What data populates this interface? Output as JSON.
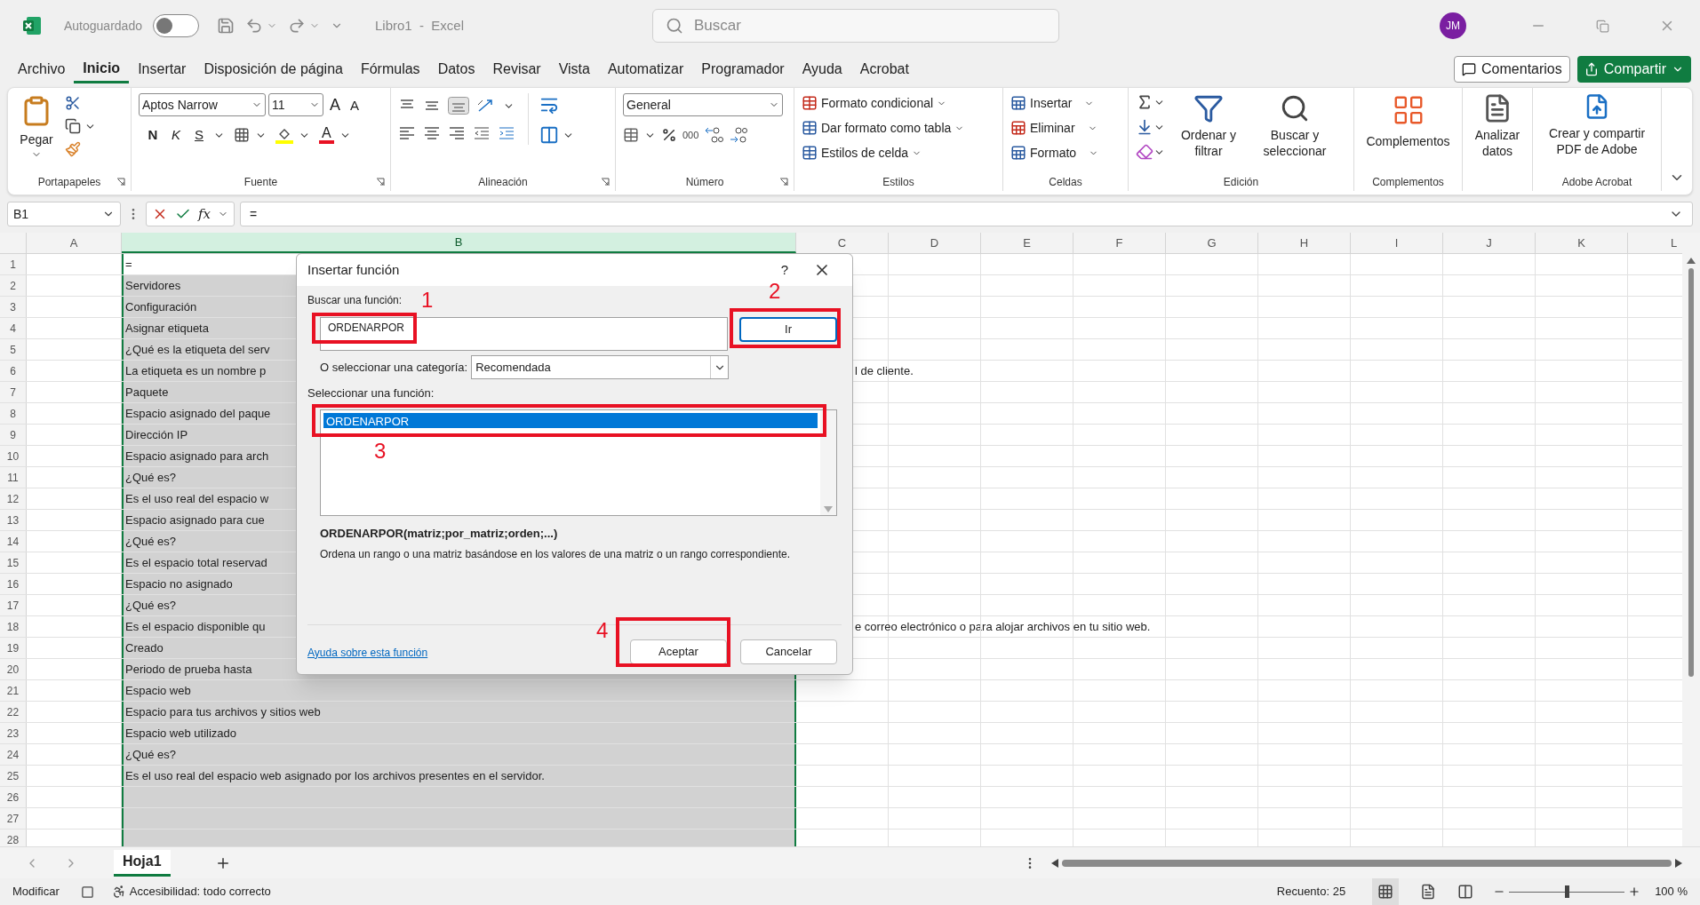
{
  "title_bar": {
    "autosave_label": "Autoguardado",
    "autosave_on": false,
    "document_title": "Libro1  -  Excel",
    "search_placeholder": "Buscar",
    "avatar": "JM"
  },
  "menu_tabs": [
    {
      "label": "Archivo",
      "selected": false
    },
    {
      "label": "Inicio",
      "selected": true
    },
    {
      "label": "Insertar",
      "selected": false
    },
    {
      "label": "Disposición de página",
      "selected": false
    },
    {
      "label": "Fórmulas",
      "selected": false
    },
    {
      "label": "Datos",
      "selected": false
    },
    {
      "label": "Revisar",
      "selected": false
    },
    {
      "label": "Vista",
      "selected": false
    },
    {
      "label": "Automatizar",
      "selected": false
    },
    {
      "label": "Programador",
      "selected": false
    },
    {
      "label": "Ayuda",
      "selected": false
    },
    {
      "label": "Acrobat",
      "selected": false
    }
  ],
  "comments_button": "Comentarios",
  "share_button": "Compartir",
  "ribbon": {
    "clipboard": {
      "label": "Portapapeles",
      "paste": "Pegar"
    },
    "font": {
      "label": "Fuente",
      "family": "Aptos Narrow",
      "size": "11",
      "grow": "A",
      "shrink": "A",
      "bold": "N",
      "italic": "K",
      "underline": "S",
      "color_letter": "A"
    },
    "alignment": {
      "label": "Alineación"
    },
    "number": {
      "label": "Número",
      "format": "General",
      "thousands": "000"
    },
    "styles": {
      "label": "Estilos",
      "items": [
        "Formato condicional",
        "Dar formato como tabla",
        "Estilos de celda"
      ]
    },
    "cells": {
      "label": "Celdas",
      "items": [
        "Insertar",
        "Eliminar",
        "Formato"
      ]
    },
    "editing": {
      "label": "Edición",
      "sort": "Ordenar y filtrar",
      "find": "Buscar y seleccionar"
    },
    "addins": {
      "label": "Complementos",
      "button": "Complementos"
    },
    "analyze": {
      "button": "Analizar datos"
    },
    "acrobat": {
      "label": "Adobe Acrobat",
      "button": "Crear y compartir PDF de Adobe"
    }
  },
  "formula_bar": {
    "name_box": "B1",
    "fx": "fx",
    "formula": "="
  },
  "columns": [
    {
      "label": "A",
      "selected": false
    },
    {
      "label": "B",
      "selected": true
    },
    {
      "label": "C",
      "selected": false
    },
    {
      "label": "D",
      "selected": false
    },
    {
      "label": "E",
      "selected": false
    },
    {
      "label": "F",
      "selected": false
    },
    {
      "label": "G",
      "selected": false
    },
    {
      "label": "H",
      "selected": false
    },
    {
      "label": "I",
      "selected": false
    },
    {
      "label": "J",
      "selected": false
    },
    {
      "label": "K",
      "selected": false
    },
    {
      "label": "L",
      "selected": false
    }
  ],
  "rows": [
    {
      "number": "1",
      "b": "=",
      "active": true
    },
    {
      "number": "2",
      "b": "Servidores",
      "active": false
    },
    {
      "number": "3",
      "b": "Configuración",
      "active": false
    },
    {
      "number": "4",
      "b": "Asignar etiqueta",
      "active": false
    },
    {
      "number": "5",
      "b": "¿Qué es la etiqueta del serv",
      "active": false
    },
    {
      "number": "6",
      "b": "La etiqueta es un nombre p",
      "b_overflow": "l de cliente.",
      "active": false
    },
    {
      "number": "7",
      "b": "Paquete",
      "active": false
    },
    {
      "number": "8",
      "b": "Espacio asignado del paque",
      "active": false
    },
    {
      "number": "9",
      "b": "Dirección IP",
      "active": false
    },
    {
      "number": "10",
      "b": "Espacio asignado para arch",
      "active": false
    },
    {
      "number": "11",
      "b": "¿Qué es?",
      "active": false
    },
    {
      "number": "12",
      "b": "Es el uso real del espacio w",
      "active": false
    },
    {
      "number": "13",
      "b": "Espacio asignado para cue",
      "active": false
    },
    {
      "number": "14",
      "b": "¿Qué es?",
      "active": false
    },
    {
      "number": "15",
      "b": "Es el espacio total reservad",
      "active": false
    },
    {
      "number": "16",
      "b": "Espacio no asignado",
      "active": false
    },
    {
      "number": "17",
      "b": "¿Qué es?",
      "active": false
    },
    {
      "number": "18",
      "b": "Es el espacio disponible qu",
      "b_overflow": "e correo electrónico o para alojar archivos en tu sitio web.",
      "active": false
    },
    {
      "number": "19",
      "b": "Creado",
      "active": false
    },
    {
      "number": "20",
      "b": "Periodo de prueba hasta",
      "active": false
    },
    {
      "number": "21",
      "b": "Espacio web",
      "active": false
    },
    {
      "number": "22",
      "b": "Espacio para tus archivos y sitios web",
      "active": false
    },
    {
      "number": "23",
      "b": "Espacio web utilizado",
      "active": false
    },
    {
      "number": "24",
      "b": "¿Qué es?",
      "active": false
    },
    {
      "number": "25",
      "b": "Es el uso real del espacio web asignado por los archivos presentes en el servidor.",
      "active": false
    },
    {
      "number": "26",
      "active": false
    },
    {
      "number": "27",
      "active": false
    },
    {
      "number": "28",
      "active": false
    }
  ],
  "dialog": {
    "title": "Insertar función",
    "help": "?",
    "search_label": "Buscar una función:",
    "search_value": "ORDENARPOR",
    "go_button": "Ir",
    "category_label": "O seleccionar una categoría:",
    "category": "Recomendada",
    "list_label": "Seleccionar una función:",
    "functions": [
      {
        "name": "ORDENARPOR",
        "selected": true
      }
    ],
    "signature": "ORDENARPOR(matriz;por_matriz;orden;...)",
    "description": "Ordena un rango o una matriz basándose en los valores de una matriz o un rango correspondiente.",
    "help_link": "Ayuda sobre esta función",
    "ok_button": "Aceptar",
    "cancel_button": "Cancelar",
    "annotations": [
      {
        "number": "1"
      },
      {
        "number": "2"
      },
      {
        "number": "3"
      },
      {
        "number": "4"
      }
    ]
  },
  "sheet_tabs": [
    {
      "label": "Hoja1",
      "selected": true
    }
  ],
  "status_bar": {
    "mode": "Modificar",
    "accessibility": "Accesibilidad: todo correcto",
    "count": "Recuento: 25",
    "zoom": "100 %",
    "zoom_level": {
      "level": 0.5
    }
  }
}
